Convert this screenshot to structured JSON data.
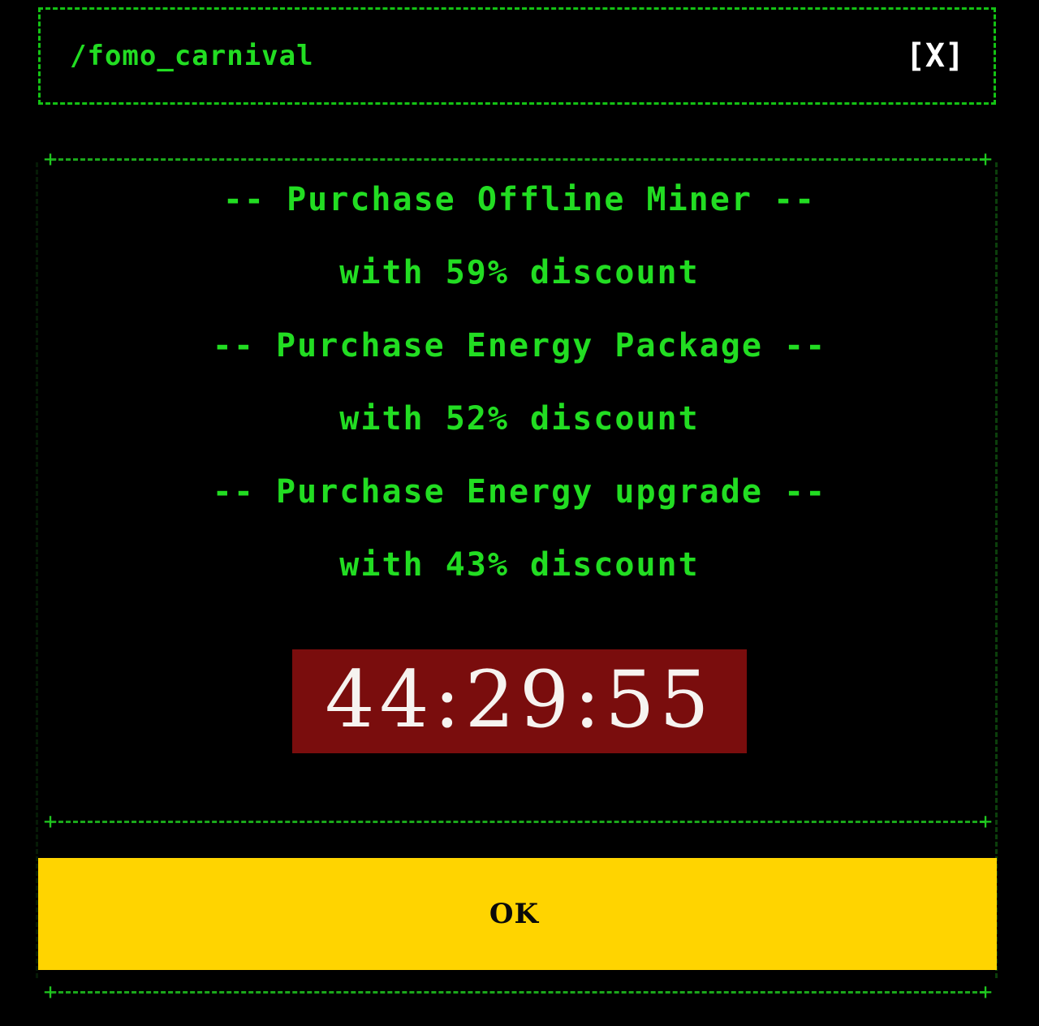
{
  "window": {
    "title": "/fomo_carnival",
    "close_label": "[X]",
    "close_icon": "close-icon"
  },
  "theme": {
    "background": "#000000",
    "accent_green": "#22dd22",
    "border_green": "#14c214",
    "timer_bg": "#7a0d0d",
    "timer_fg": "#f6f3f0",
    "button_bg": "#FFD400",
    "button_fg": "#0a0a0a",
    "close_fg": "#ffffff"
  },
  "offers": [
    {
      "title": "-- Purchase Offline Miner --",
      "subtitle": "with 59% discount",
      "discount": 59
    },
    {
      "title": "-- Purchase Energy Package --",
      "subtitle": "with 52% discount",
      "discount": 52
    },
    {
      "title": "-- Purchase Energy upgrade --",
      "subtitle": "with 43% discount",
      "discount": 43
    }
  ],
  "countdown": {
    "value": "44:29:55",
    "hours": "44",
    "minutes": "29",
    "seconds": "55"
  },
  "footer": {
    "ok_label": "OK"
  },
  "separators": {
    "plus_glyph": "+"
  }
}
